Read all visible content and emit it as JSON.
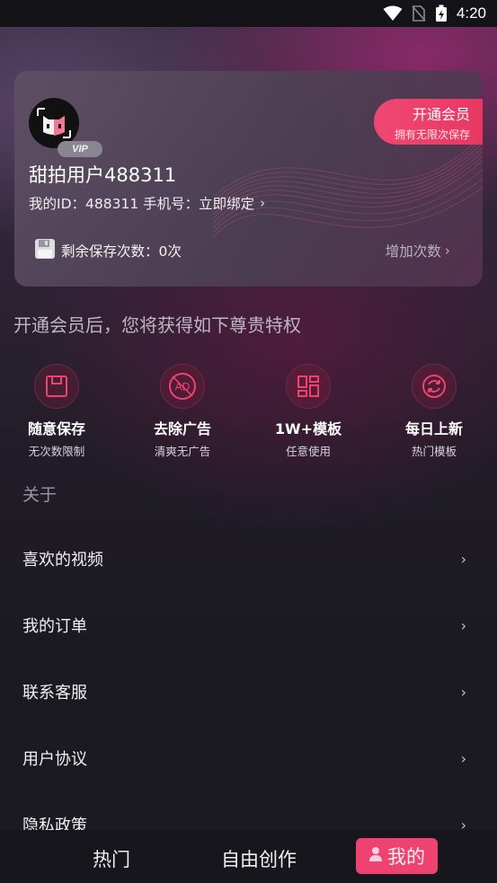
{
  "status_bar": {
    "time": "4:20",
    "icons": [
      "wifi-icon",
      "no-sim-icon",
      "battery-charging-icon"
    ]
  },
  "profile": {
    "avatar_icon": "cat-mask-avatar",
    "vip_badge": "VIP",
    "username": "甜拍用户488311",
    "id_line": "我的ID：488311  手机号：立即绑定",
    "chevron": "›",
    "vip_button": {
      "title": "开通会员",
      "subtitle": "拥有无限次保存"
    },
    "saves_remaining": "剩余保存次数：0次",
    "add_times": "增加次数",
    "save_icon": "floppy-icon"
  },
  "privileges": {
    "heading": "开通会员后，您将获得如下尊贵特权",
    "items": [
      {
        "icon": "save-icon",
        "title": "随意保存",
        "subtitle": "无次数限制"
      },
      {
        "icon": "no-ad-icon",
        "title": "去除广告",
        "subtitle": "清爽无广告"
      },
      {
        "icon": "template-grid-icon",
        "title": "1W+模板",
        "subtitle": "任意使用"
      },
      {
        "icon": "refresh-icon",
        "title": "每日上新",
        "subtitle": "热门模板"
      }
    ]
  },
  "about": {
    "heading": "关于",
    "items": [
      {
        "label": "喜欢的视频"
      },
      {
        "label": "我的订单"
      },
      {
        "label": "联系客服"
      },
      {
        "label": "用户协议"
      },
      {
        "label": "隐私政策"
      }
    ],
    "chevron": "›"
  },
  "bottom_nav": {
    "tabs": [
      "热门",
      "自由创作",
      "我的"
    ],
    "active": "我的"
  },
  "colors": {
    "accent": "#f04270",
    "background": "#1b1a22"
  }
}
